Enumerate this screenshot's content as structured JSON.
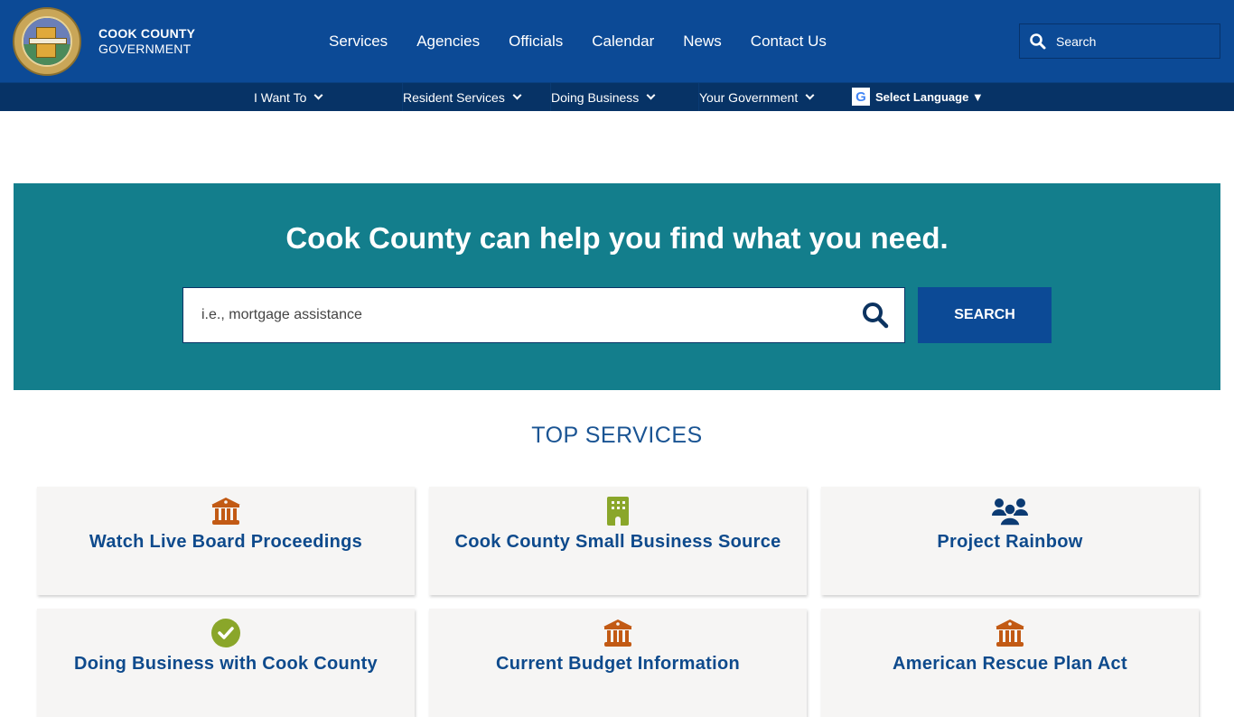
{
  "header": {
    "brand_line1": "COOK COUNTY",
    "brand_line2": "GOVERNMENT",
    "nav": [
      "Services",
      "Agencies",
      "Officials",
      "Calendar",
      "News",
      "Contact Us"
    ],
    "search_placeholder": "Search"
  },
  "subnav": {
    "items": [
      "I Want To",
      "Resident Services",
      "Doing Business",
      "Your Government"
    ],
    "language_label": "Select Language ▼",
    "google_glyph": "G"
  },
  "hero": {
    "title": "Cook County can help you find what you need.",
    "search_placeholder": "i.e., mortgage assistance",
    "search_button": "SEARCH"
  },
  "top_services": {
    "title": "TOP SERVICES",
    "cards": [
      {
        "label": "Watch Live Board Proceedings",
        "icon": "landmark-icon",
        "icon_color": "#c25a14"
      },
      {
        "label": "Cook County Small Business Source",
        "icon": "building-icon",
        "icon_color": "#8aa62a"
      },
      {
        "label": "Project Rainbow",
        "icon": "users-icon",
        "icon_color": "#0c3b73"
      },
      {
        "label": "Doing Business with Cook County",
        "icon": "check-circle-icon",
        "icon_color": "#8aa62a"
      },
      {
        "label": "Current Budget Information",
        "icon": "landmark-icon",
        "icon_color": "#c25a14"
      },
      {
        "label": "American Rescue Plan Act",
        "icon": "landmark-icon",
        "icon_color": "#c25a14"
      }
    ]
  },
  "colors": {
    "header_blue": "#0c4a96",
    "subnav_blue": "#073366",
    "hero_teal": "#137e8c",
    "card_bg": "#f6f5f4",
    "link_blue": "#0e4a8c"
  }
}
